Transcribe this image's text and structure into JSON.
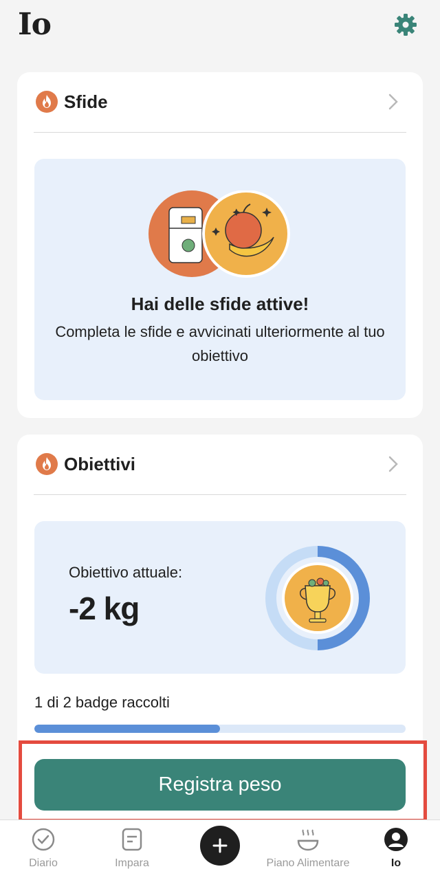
{
  "header": {
    "title": "Io",
    "settings_icon": "gear-icon"
  },
  "sfide": {
    "title": "Sfide",
    "heading": "Hai delle sfide attive!",
    "description": "Completa le sfide e avvicinati ulteriormente al tuo obiettivo"
  },
  "obiettivi": {
    "title": "Obiettivi",
    "current_label": "Obiettivo attuale:",
    "current_value": "-2 kg",
    "badges_text": "1 di 2 badge raccolti",
    "badges_progress": 0.5
  },
  "cta": {
    "label": "Registra peso"
  },
  "tabs": [
    {
      "label": "Diario",
      "icon": "check-circle-icon"
    },
    {
      "label": "Impara",
      "icon": "document-icon"
    },
    {
      "label": "",
      "icon": "plus-icon"
    },
    {
      "label": "Piano Alimentare",
      "icon": "bowl-icon"
    },
    {
      "label": "Io",
      "icon": "user-icon"
    }
  ],
  "colors": {
    "accent": "#3a8478",
    "flame": "#e07a4a",
    "highlight": "#e44b3f",
    "progress": "#5b8fd8"
  }
}
